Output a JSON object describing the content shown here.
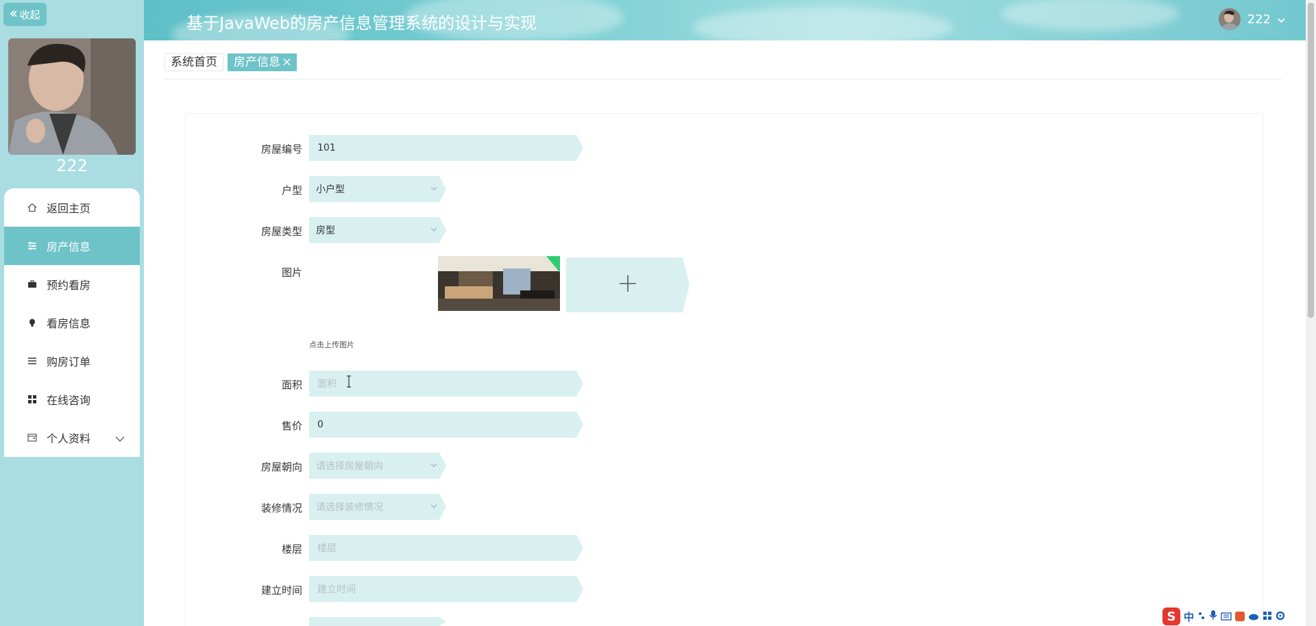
{
  "sidebar": {
    "collapse_label": "收起",
    "username": "222",
    "items": [
      {
        "label": "返回主页",
        "icon": "home-icon"
      },
      {
        "label": "房产信息",
        "icon": "sliders-icon"
      },
      {
        "label": "预约看房",
        "icon": "briefcase-icon"
      },
      {
        "label": "看房信息",
        "icon": "bulb-icon"
      },
      {
        "label": "购房订单",
        "icon": "list-icon"
      },
      {
        "label": "在线咨询",
        "icon": "grid-icon"
      },
      {
        "label": "个人资料",
        "icon": "wallet-icon"
      }
    ]
  },
  "header": {
    "title": "基于JavaWeb的房产信息管理系统的设计与实现",
    "user": "222"
  },
  "tabs": [
    {
      "label": "系统首页"
    },
    {
      "label": "房产信息"
    }
  ],
  "form": {
    "house_no": {
      "label": "房屋编号",
      "value": "101"
    },
    "layout": {
      "label": "户型",
      "value": "小户型"
    },
    "house_type": {
      "label": "房屋类型",
      "value": "房型"
    },
    "image": {
      "label": "图片",
      "tip": "点击上传图片"
    },
    "area": {
      "label": "面积",
      "placeholder": "面积"
    },
    "price": {
      "label": "售价",
      "value": "0"
    },
    "orientation": {
      "label": "房屋朝向",
      "placeholder": "请选择房屋朝向"
    },
    "decoration": {
      "label": "装修情况",
      "placeholder": "请选择装修情况"
    },
    "floor": {
      "label": "楼层",
      "placeholder": "楼层"
    },
    "built_time": {
      "label": "建立时间",
      "placeholder": "建立时间"
    }
  },
  "ime": {
    "lang": "中"
  },
  "colors": {
    "accent": "#6ec3c9",
    "sidebar_bg": "#a9dde2",
    "field_bg": "#d9f0f1"
  }
}
